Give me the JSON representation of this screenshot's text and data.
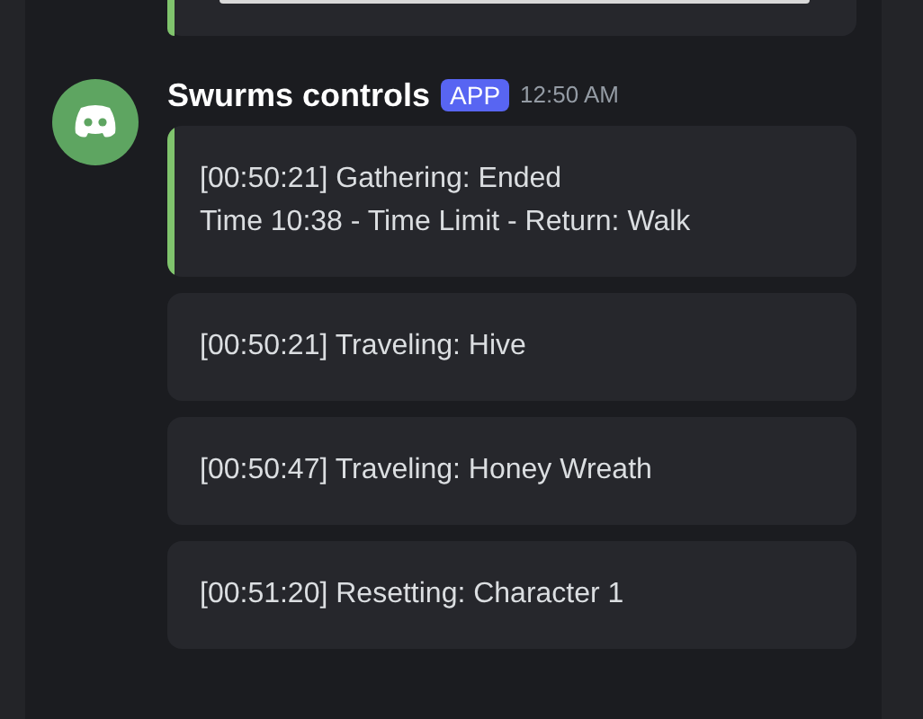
{
  "previous_embed": {
    "color": "#80c46d"
  },
  "message": {
    "author": "Swurms controls",
    "badge": "APP",
    "time": "12:50 AM",
    "embeds": [
      {
        "lines": [
          "[00:50:21] Gathering: Ended",
          "Time 10:38 - Time Limit - Return: Walk"
        ],
        "color": "#80c46d"
      },
      {
        "lines": [
          "[00:50:21] Traveling: Hive"
        ]
      },
      {
        "lines": [
          "[00:50:47] Traveling: Honey Wreath"
        ]
      },
      {
        "lines": [
          "[00:51:20] Resetting: Character 1"
        ]
      }
    ]
  }
}
